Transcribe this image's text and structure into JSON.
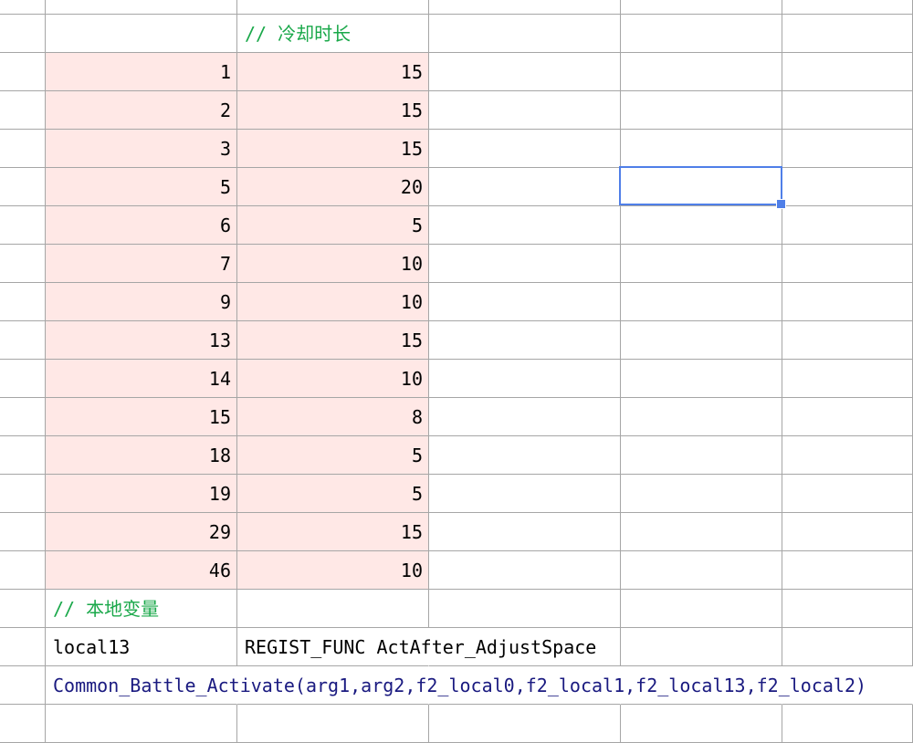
{
  "sheet": {
    "header_comment": "// 冷却时长",
    "rows": [
      {
        "id": "1",
        "cooldown": "15"
      },
      {
        "id": "2",
        "cooldown": "15"
      },
      {
        "id": "3",
        "cooldown": "15"
      },
      {
        "id": "5",
        "cooldown": "20"
      },
      {
        "id": "6",
        "cooldown": "5"
      },
      {
        "id": "7",
        "cooldown": "10"
      },
      {
        "id": "9",
        "cooldown": "10"
      },
      {
        "id": "13",
        "cooldown": "15"
      },
      {
        "id": "14",
        "cooldown": "10"
      },
      {
        "id": "15",
        "cooldown": "8"
      },
      {
        "id": "18",
        "cooldown": "5"
      },
      {
        "id": "19",
        "cooldown": "5"
      },
      {
        "id": "29",
        "cooldown": "15"
      },
      {
        "id": "46",
        "cooldown": "10"
      }
    ],
    "local_var_comment": "// 本地变量",
    "local_var_name": "local13",
    "local_var_value": "REGIST_FUNC ActAfter_AdjustSpace",
    "code_line": "Common_Battle_Activate(arg1,arg2,f2_local0,f2_local1,f2_local13,f2_local2)",
    "colors": {
      "pink_fill": "#ffe8e6",
      "comment_text": "#1aa84a",
      "code_text": "#1a1a80",
      "selection": "#4f7fe8"
    }
  }
}
